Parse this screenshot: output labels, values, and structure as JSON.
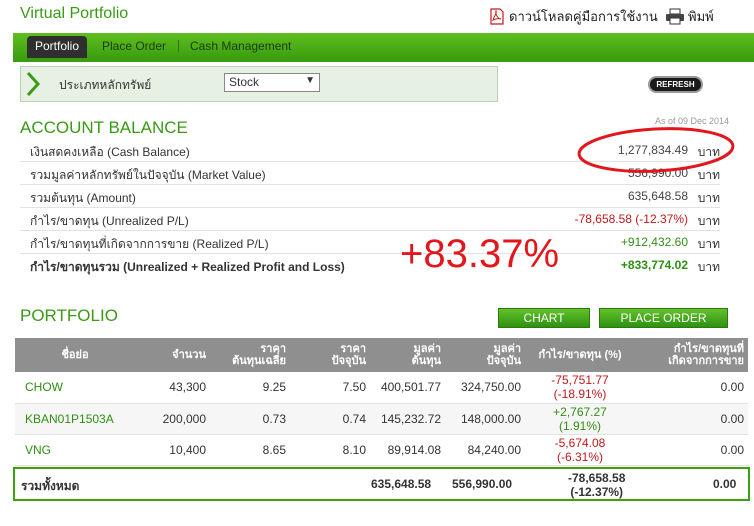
{
  "header": {
    "title": "Virtual Portfolio",
    "download_label": "ดาวน์โหลดคู่มือการใช้งาน",
    "print_label": "พิมพ์"
  },
  "tabs": [
    {
      "label": "Portfolio",
      "active": true
    },
    {
      "label": "Place Order",
      "active": false
    },
    {
      "label": "Cash Management",
      "active": false
    }
  ],
  "filter": {
    "label": "ประเภทหลักทรัพย์",
    "selected": "Stock"
  },
  "refresh_label": "REFRESH",
  "account_balance": {
    "title": "ACCOUNT BALANCE",
    "as_of": "As of 09 Dec 2014",
    "unit": "บาท",
    "rows": [
      {
        "label": "เงินสดคงเหลือ (Cash Balance)",
        "value": "1,277,834.49"
      },
      {
        "label": "รวมมูลค่าหลักทรัพย์ในปัจจุบัน (Market Value)",
        "value": "556,990.00"
      },
      {
        "label": "รวมต้นทุน (Amount)",
        "value": "635,648.58"
      },
      {
        "label": "กำไร/ขาดทุน (Unrealized P/L)",
        "value": "-78,658.58 (-12.37%)"
      },
      {
        "label": "กำไร/ขาดทุนที่เกิดจากการขาย (Realized P/L)",
        "value": "+912,432.60"
      },
      {
        "label": "กำไร/ขาดทุนรวม (Unrealized + Realized Profit and Loss)",
        "value": "+833,774.02"
      }
    ],
    "highlight_pct": "+83.37%"
  },
  "portfolio": {
    "title": "PORTFOLIO",
    "chart_button": "CHART",
    "place_order_button": "PLACE ORDER",
    "columns": {
      "symbol": "ชื่อย่อ",
      "volume": "จำนวน",
      "avg_cost_1": "ราคา",
      "avg_cost_2": "ต้นทุนเฉลี่ย",
      "market_price_1": "ราคา",
      "market_price_2": "ปัจจุบัน",
      "amount_1": "มูลค่า",
      "amount_2": "ต้นทุน",
      "market_value_1": "มูลค่า",
      "market_value_2": "ปัจจุบัน",
      "unrealized": "กำไร/ขาดทุน (%)",
      "realized_1": "กำไร/ขาดทุนที่",
      "realized_2": "เกิดจากการขาย"
    },
    "rows": [
      {
        "symbol": "CHOW",
        "volume": "43,300",
        "avg_cost": "9.25",
        "market_price": "7.50",
        "amount": "400,501.77",
        "market_value": "324,750.00",
        "pl": "-75,751.77",
        "pl_pct": "(-18.91%)",
        "realized": "0.00"
      },
      {
        "symbol": "KBAN01P1503A",
        "volume": "200,000",
        "avg_cost": "0.73",
        "market_price": "0.74",
        "amount": "145,232.72",
        "market_value": "148,000.00",
        "pl": "+2,767.27",
        "pl_pct": "(1.91%)",
        "realized": "0.00"
      },
      {
        "symbol": "VNG",
        "volume": "10,400",
        "avg_cost": "8.65",
        "market_price": "8.10",
        "amount": "89,914.08",
        "market_value": "84,240.00",
        "pl": "-5,674.08",
        "pl_pct": "(-6.31%)",
        "realized": "0.00"
      }
    ],
    "total": {
      "label": "รวมทั้งหมด",
      "amount": "635,648.58",
      "market_value": "556,990.00",
      "pl": "-78,658.58",
      "pl_pct": "(-12.37%)",
      "realized": "0.00"
    }
  },
  "colors": {
    "brand_green": "#3a9a17",
    "negative": "#c2181d",
    "positive": "#2f8f12",
    "annotation_red": "#e2161b"
  }
}
